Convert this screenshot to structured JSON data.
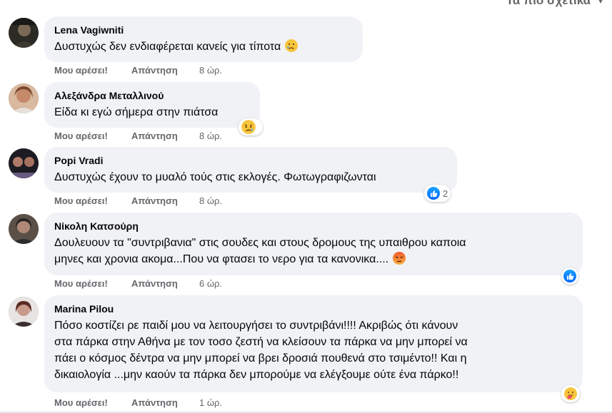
{
  "sort_label": "Τα πιο σχετικά",
  "comments": [
    {
      "author": "Lena Vagiwniti",
      "text": "Δυστυχώς δεν ενδιαφέρεται κανείς για τίποτα",
      "like": "Μου αρέσει!",
      "reply": "Απάντηση",
      "time": "8 ώρ."
    },
    {
      "author": "Αλεξάνδρα Μεταλλινού",
      "text": "Είδα κι εγώ σήμερα στην πιάτσα",
      "like": "Μου αρέσει!",
      "reply": "Απάντηση",
      "time": "8 ώρ."
    },
    {
      "author": "Popi Vradi",
      "text": "Δυστυχώς έχουν το μυαλό τούς στις εκλογές. Φωτωγραφιζωνται",
      "like": "Μου αρέσει!",
      "reply": "Απάντηση",
      "time": "8 ώρ.",
      "reaction_count": "2"
    },
    {
      "author": "Νίκολη Κατσούρη",
      "text_lines": [
        "Δουλευουν τα \"συντριβανια\" στις σουδες και στους δρομους της υπαιθρου καποια",
        "μηνες και χρονια ακομα...Που να φτασει το νερο για τα κανονικα...."
      ],
      "like": "Μου αρέσει!",
      "reply": "Απάντηση",
      "time": "6 ώρ."
    },
    {
      "author": "Marina Pilou",
      "text_lines": [
        "Πόσο κοστίζει ρε παιδί μου να λειτουργήσει το συντριβάνι!!!! Ακριβώς ότι κάνουν",
        "στα πάρκα στην Αθήνα με τον τοσο ζεστή να κλείσουν τα πάρκα να μην μπορεί να",
        "πάει ο κόσμος δέντρα να μην μπορεί να βρει δροσιά πουθενά στο τσιμέντο!! Και η",
        "δικαιολογία ...μην καούν τα πάρκα δεν μπορούμε να ελέγξουμε ούτε ένα πάρκο!!"
      ],
      "like": "Μου αρέσει!",
      "reply": "Απάντηση",
      "time": "1 ώρ."
    }
  ]
}
